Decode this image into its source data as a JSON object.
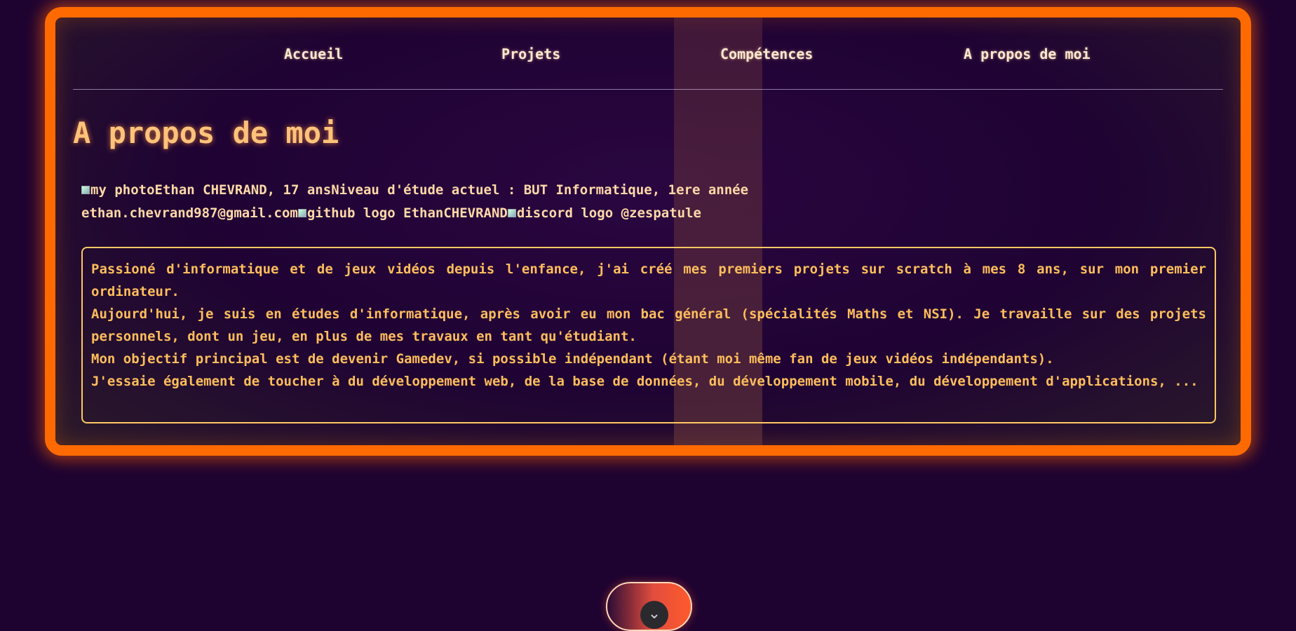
{
  "nav": {
    "items": [
      {
        "label": "Accueil"
      },
      {
        "label": "Projets"
      },
      {
        "label": "Compétences"
      },
      {
        "label": "A propos de moi"
      }
    ]
  },
  "page": {
    "title": "A propos de moi"
  },
  "info": {
    "photo_alt": "my photo",
    "name_age": "Ethan CHEVRAND, 17 ans",
    "education": "Niveau d'étude actuel : BUT Informatique, 1ere année",
    "email": "ethan.chevrand987@gmail.com",
    "github_alt": "github logo",
    "github_user": " EthanCHEVRAND",
    "discord_alt": "discord logo",
    "discord_user": " @zespatule"
  },
  "bio": {
    "paragraphs": [
      "Passioné d'informatique et de jeux vidéos depuis l'enfance, j'ai créé mes premiers projets sur scratch à mes 8 ans, sur mon premier ordinateur.",
      "Aujourd'hui, je suis en études d'informatique, après avoir eu mon bac général (spécialités Maths et NSI). Je travaille sur des projets personnels, dont un jeu, en plus de mes travaux en tant qu'étudiant.",
      "Mon objectif principal est de devenir Gamedev, si possible indépendant (étant moi même fan de jeux vidéos indépendants).",
      "J'essaie également de toucher à du développement web, de la base de données, du développement mobile, du développement d'applications, ..."
    ]
  },
  "toggle": {
    "icon": "chevron-down-icon",
    "glyph": "⌄"
  },
  "colors": {
    "frame_border": "#ff6a00",
    "background": "#1e0330",
    "title": "#ffc27a",
    "bio_text": "#ffbe5c",
    "bio_border": "#ffc861"
  }
}
